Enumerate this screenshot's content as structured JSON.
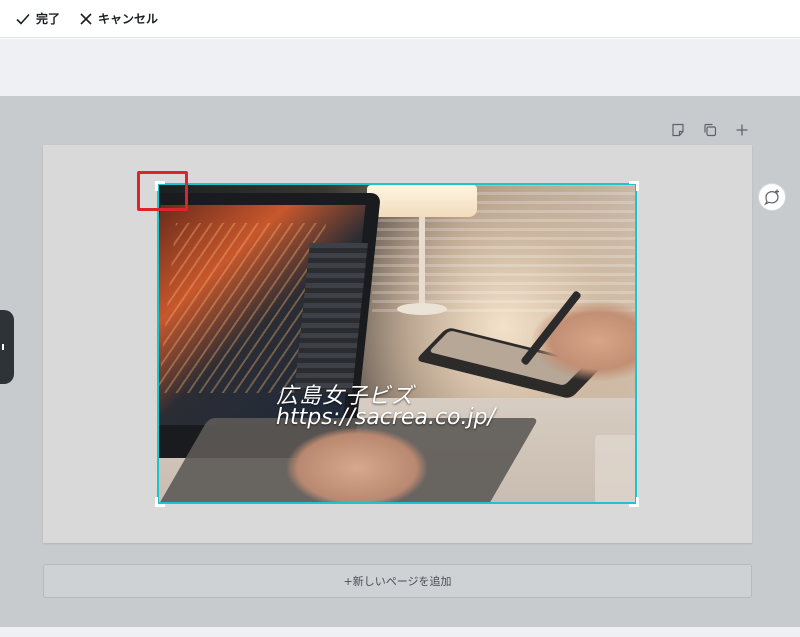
{
  "toolbar": {
    "done_label": "完了",
    "cancel_label": "キャンセル"
  },
  "canvas": {
    "overlay_title": "広島女子ビズ",
    "overlay_url": "https://sacrea.co.jp/",
    "add_page_label": "+新しいページを追加"
  },
  "icons": {
    "done": "check-icon",
    "cancel": "close-icon",
    "page_notes": "note-icon",
    "duplicate": "duplicate-icon",
    "add": "plus-icon",
    "comment": "add-comment-icon"
  },
  "colors": {
    "crop_border": "#1fc3cc",
    "highlight": "#d9252c",
    "workspace": "#c8cbce"
  }
}
